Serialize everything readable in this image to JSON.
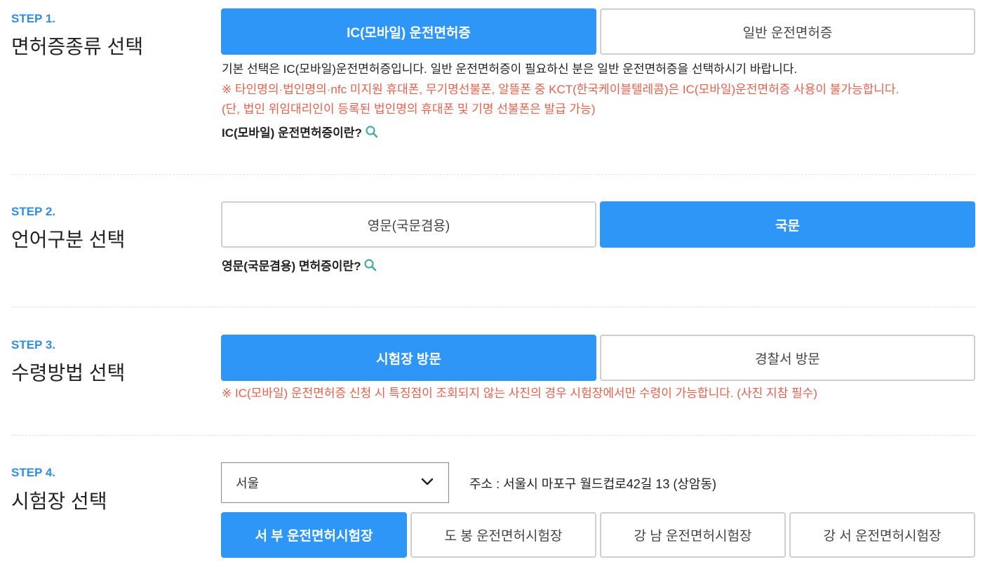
{
  "step1": {
    "step_no": "STEP 1.",
    "title": "면허증종류 선택",
    "options": [
      "IC(모바일) 운전면허증",
      "일반 운전면허증"
    ],
    "selected": 0,
    "desc": "기본 선택은 IC(모바일)운전면허증입니다. 일반 운전면허증이 필요하신 분은 일반 운전면허증을 선택하시기 바랍니다.",
    "notice1": "※ 타인명의·법인명의·nfc 미지원 휴대폰, 무기명선불폰, 알뜰폰 중 KCT(한국케이블텔레콤)은 IC(모바일)운전면허증 사용이 불가능합니다.",
    "notice2": "(단, 법인 위임대리인이 등록된 법인명의 휴대폰 및 기명 선불폰은 발급 가능)",
    "info_link": "IC(모바일) 운전면허증이란?"
  },
  "step2": {
    "step_no": "STEP 2.",
    "title": "언어구분 선택",
    "options": [
      "영문(국문겸용)",
      "국문"
    ],
    "selected": 1,
    "info_link": "영문(국문겸용) 면허증이란?"
  },
  "step3": {
    "step_no": "STEP 3.",
    "title": "수령방법 선택",
    "options": [
      "시험장 방문",
      "경찰서 방문"
    ],
    "selected": 0,
    "notice": "※ IC(모바일) 운전면허증 신청 시 특징점이 조회되지 않는 사진의 경우 시험장에서만 수령이 가능합니다. (사진 지참 필수)"
  },
  "step4": {
    "step_no": "STEP 4.",
    "title": "시험장 선택",
    "region_value": "서울",
    "address": "주소 : 서울시 마포구 월드컵로42길 13 (상암동)",
    "centers": [
      "서 부 운전면허시험장",
      "도 봉 운전면허시험장",
      "강 남 운전면허시험장",
      "강 서 운전면허시험장"
    ],
    "selected": 0
  },
  "colors": {
    "accent": "#2d96f7",
    "step_label": "#2f8de4",
    "notice": "#e8604c",
    "search_icon": "#4aa9a4"
  },
  "icons": {
    "search": "search-icon",
    "dropdown": "chevron-down-icon"
  }
}
